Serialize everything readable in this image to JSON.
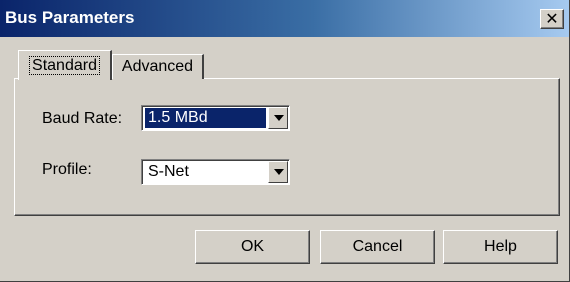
{
  "window": {
    "title": "Bus Parameters",
    "close_glyph": "✕"
  },
  "tabs": [
    {
      "label": "Standard",
      "active": true
    },
    {
      "label": "Advanced",
      "active": false
    }
  ],
  "fields": {
    "baud_rate": {
      "label": "Baud Rate:",
      "value": "1.5 MBd"
    },
    "profile": {
      "label": "Profile:",
      "value": "S-Net"
    }
  },
  "buttons": {
    "ok": "OK",
    "cancel": "Cancel",
    "help": "Help"
  },
  "icons": {
    "close": "close-icon",
    "dropdown": "chevron-down-icon"
  },
  "colors": {
    "title_bar_start": "#0a246a",
    "title_bar_end": "#a6caf0",
    "face": "#d4d0c8",
    "selection": "#0a246a"
  }
}
